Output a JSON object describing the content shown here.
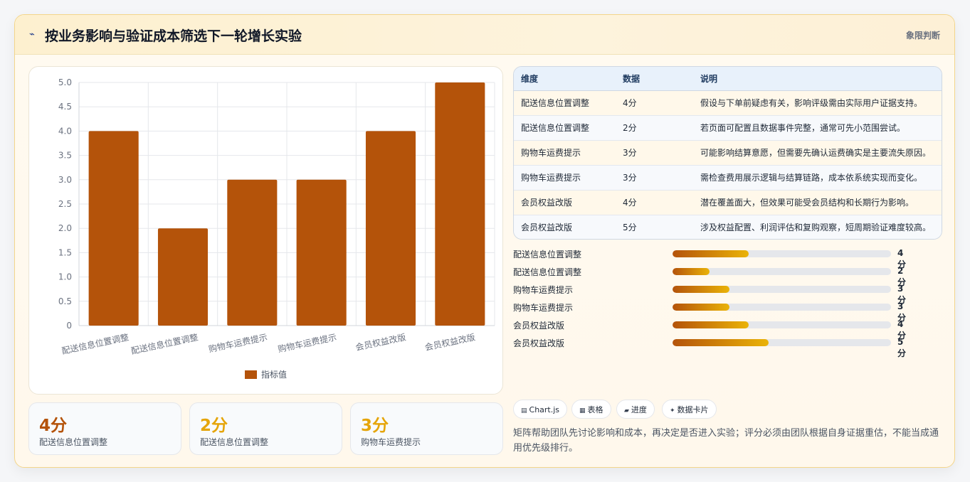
{
  "header": {
    "icon": "lightning-icon",
    "title": "按业务影响与验证成本筛选下一轮增长实验",
    "badge": "象限判断"
  },
  "chart_data": {
    "type": "bar",
    "categories": [
      "配送信息位置调整",
      "配送信息位置调整",
      "购物车运费提示",
      "购物车运费提示",
      "会员权益改版",
      "会员权益改版"
    ],
    "series": [
      {
        "name": "指标值",
        "values": [
          4,
          2,
          3,
          3,
          4,
          5
        ],
        "color": "#b4530a"
      }
    ],
    "ylim": [
      0,
      5
    ],
    "yticks": [
      "0",
      "0.5",
      "1.0",
      "1.5",
      "2.0",
      "2.5",
      "3.0",
      "3.5",
      "4.0",
      "4.5",
      "5.0"
    ],
    "grid": true,
    "legend": "bottom"
  },
  "stats": [
    {
      "value": "4分",
      "label": "配送信息位置调整",
      "color": "#b4530a"
    },
    {
      "value": "2分",
      "label": "配送信息位置调整",
      "color": "#e5a50a"
    },
    {
      "value": "3分",
      "label": "购物车运费提示",
      "color": "#e5a50a"
    }
  ],
  "table": {
    "headers": [
      "维度",
      "数据",
      "说明"
    ],
    "rows": [
      {
        "dim": "配送信息位置调整",
        "data": "4分",
        "desc": "假设与下单前疑虑有关，影响评级需由实际用户证据支持。"
      },
      {
        "dim": "配送信息位置调整",
        "data": "2分",
        "desc": "若页面可配置且数据事件完整，通常可先小范围尝试。"
      },
      {
        "dim": "购物车运费提示",
        "data": "3分",
        "desc": "可能影响结算意愿，但需要先确认运费确实是主要流失原因。"
      },
      {
        "dim": "购物车运费提示",
        "data": "3分",
        "desc": "需检查费用展示逻辑与结算链路，成本依系统实现而变化。"
      },
      {
        "dim": "会员权益改版",
        "data": "4分",
        "desc": "潜在覆盖面大，但效果可能受会员结构和长期行为影响。"
      },
      {
        "dim": "会员权益改版",
        "data": "5分",
        "desc": "涉及权益配置、利润评估和复购观察，短周期验证难度较高。"
      }
    ]
  },
  "progress": [
    {
      "label": "配送信息位置调整",
      "value": "4分",
      "fraction": 0.35
    },
    {
      "label": "配送信息位置调整",
      "value": "2分",
      "fraction": 0.17
    },
    {
      "label": "购物车运费提示",
      "value": "3分",
      "fraction": 0.26
    },
    {
      "label": "购物车运费提示",
      "value": "3分",
      "fraction": 0.26
    },
    {
      "label": "会员权益改版",
      "value": "4分",
      "fraction": 0.35
    },
    {
      "label": "会员权益改版",
      "value": "5分",
      "fraction": 0.44
    }
  ],
  "chips": [
    {
      "icon": "chart-icon",
      "glyph": "▤",
      "label": "Chart.js"
    },
    {
      "icon": "table-icon",
      "glyph": "▦",
      "label": "表格"
    },
    {
      "icon": "progress-icon",
      "glyph": "▰",
      "label": "进度"
    },
    {
      "icon": "sparkle-icon",
      "glyph": "✦",
      "label": "数据卡片"
    }
  ],
  "note": "矩阵帮助团队先讨论影响和成本，再决定是否进入实验；评分必须由团队根据自身证据重估，不能当成通用优先级排行。"
}
